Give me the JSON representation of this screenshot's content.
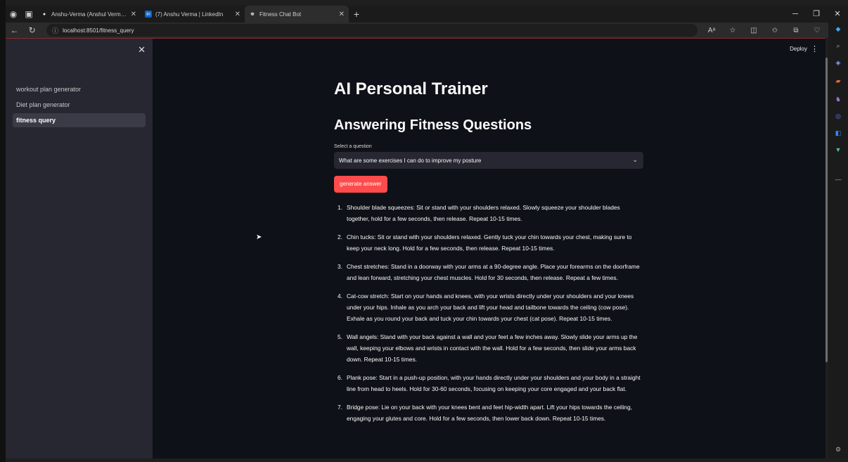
{
  "browser": {
    "tabs": [
      {
        "label": "Anshu-Verma (Anshul Verma) · Git",
        "icon": "github-icon"
      },
      {
        "label": "(7) Anshu Verma | LinkedIn",
        "icon": "linkedin-icon"
      },
      {
        "label": "Fitness Chat Bot",
        "icon": "app-icon"
      }
    ],
    "url": "localhost:8501/fitness_query"
  },
  "app": {
    "deploy_label": "Deploy",
    "sidebar": {
      "items": [
        {
          "label": "workout plan generator",
          "active": false
        },
        {
          "label": "Diet plan generator",
          "active": false
        },
        {
          "label": "fitness query",
          "active": true
        }
      ]
    },
    "title": "AI Personal Trainer",
    "subtitle": "Answering Fitness Questions",
    "select": {
      "label": "Select a question",
      "value": "What are some exercises I can do to improve my posture"
    },
    "button_label": "generate answer",
    "answers": [
      {
        "num": "1.",
        "text": "Shoulder blade squeezes: Sit or stand with your shoulders relaxed. Slowly squeeze your shoulder blades together, hold for a few seconds, then release. Repeat 10-15 times."
      },
      {
        "num": "2.",
        "text": "Chin tucks: Sit or stand with your shoulders relaxed. Gently tuck your chin towards your chest, making sure to keep your neck long. Hold for a few seconds, then release. Repeat 10-15 times."
      },
      {
        "num": "3.",
        "text": "Chest stretches: Stand in a doorway with your arms at a 90-degree angle. Place your forearms on the doorframe and lean forward, stretching your chest muscles. Hold for 30 seconds, then release. Repeat a few times."
      },
      {
        "num": "4.",
        "text": "Cat-cow stretch: Start on your hands and knees, with your wrists directly under your shoulders and your knees under your hips. Inhale as you arch your back and lift your head and tailbone towards the ceiling (cow pose). Exhale as you round your back and tuck your chin towards your chest (cat pose). Repeat 10-15 times."
      },
      {
        "num": "5.",
        "text": "Wall angels: Stand with your back against a wall and your feet a few inches away. Slowly slide your arms up the wall, keeping your elbows and wrists in contact with the wall. Hold for a few seconds, then slide your arms back down. Repeat 10-15 times."
      },
      {
        "num": "6.",
        "text": "Plank pose: Start in a push-up position, with your hands directly under your shoulders and your body in a straight line from head to heels. Hold for 30-60 seconds, focusing on keeping your core engaged and your back flat."
      },
      {
        "num": "7.",
        "text": "Bridge pose: Lie on your back with your knees bent and feet hip-width apart. Lift your hips towards the ceiling, engaging your glutes and core. Hold for a few seconds, then lower back down. Repeat 10-15 times."
      }
    ]
  }
}
